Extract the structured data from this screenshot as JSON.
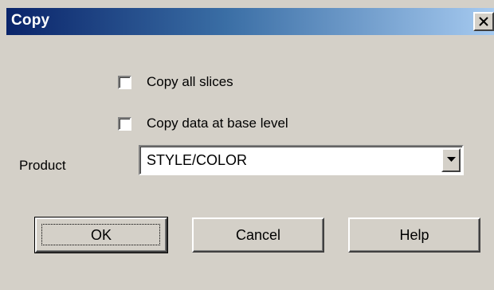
{
  "window": {
    "title": "Copy",
    "close_symbol": "×"
  },
  "options": {
    "copy_all_slices": {
      "label": "Copy all slices",
      "checked": false
    },
    "copy_data_base_level": {
      "label": "Copy data at base level",
      "checked": false
    }
  },
  "product": {
    "label": "Product",
    "selected": "STYLE/COLOR"
  },
  "buttons": {
    "ok": "OK",
    "cancel": "Cancel",
    "help": "Help"
  }
}
